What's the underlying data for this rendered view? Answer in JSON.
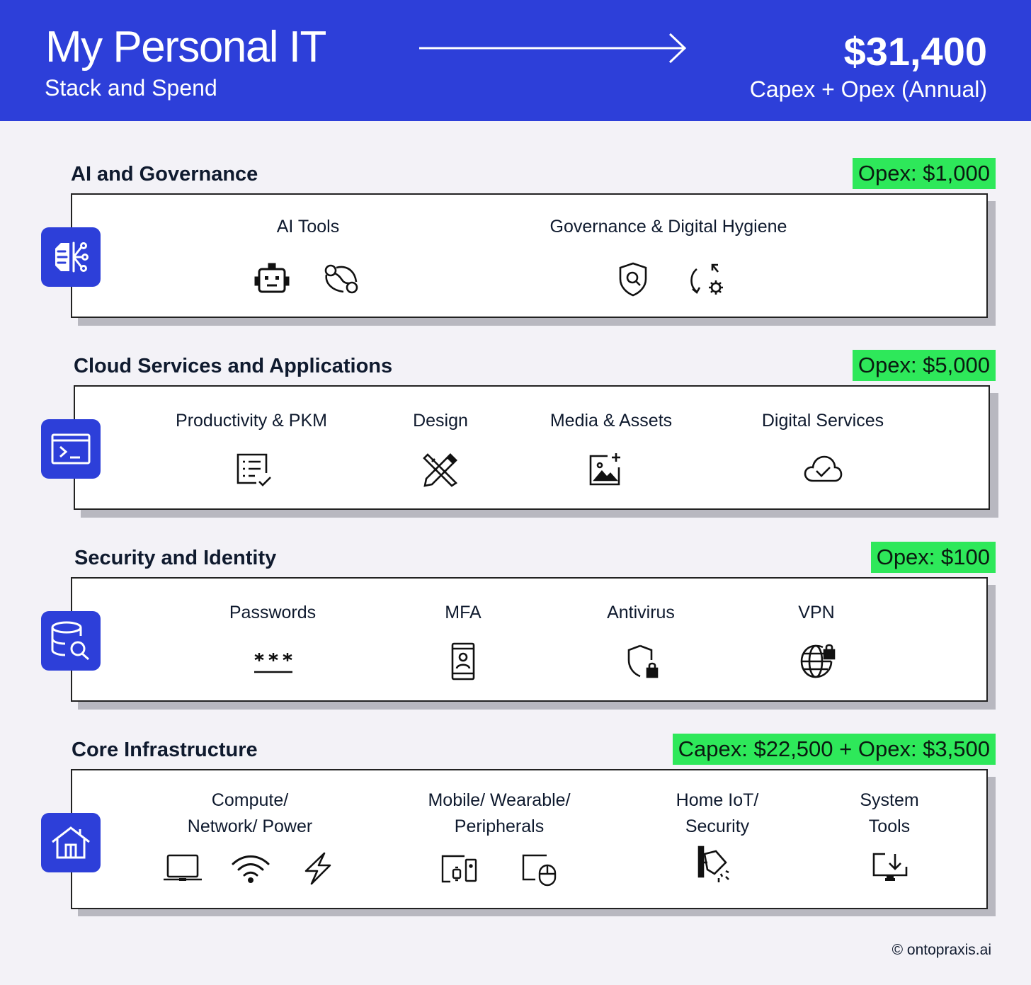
{
  "header": {
    "title": "My Personal IT",
    "subtitle": "Stack and Spend",
    "total": "$31,400",
    "total_caption": "Capex + Opex (Annual)"
  },
  "sections": [
    {
      "title": "AI and Governance",
      "badge": "Opex: $1,000",
      "icon": "ai-brain-network-icon",
      "items": [
        {
          "label": "AI Tools",
          "icons": [
            "robot-icon",
            "workflow-path-icon"
          ]
        },
        {
          "label": "Governance & Digital Hygiene",
          "icons": [
            "shield-search-icon",
            "refresh-settings-icon"
          ]
        }
      ]
    },
    {
      "title": "Cloud Services and Applications",
      "badge": "Opex: $5,000",
      "icon": "terminal-window-icon",
      "items": [
        {
          "label": "Productivity & PKM",
          "icons": [
            "checklist-icon"
          ]
        },
        {
          "label": "Design",
          "icons": [
            "pencil-ruler-icon"
          ]
        },
        {
          "label": "Media & Assets",
          "icons": [
            "add-image-icon"
          ]
        },
        {
          "label": "Digital Services",
          "icons": [
            "cloud-check-icon"
          ]
        }
      ]
    },
    {
      "title": "Security and Identity",
      "badge": "Opex: $100",
      "icon": "database-search-icon",
      "items": [
        {
          "label": "Passwords",
          "icons": [
            "password-field-icon"
          ]
        },
        {
          "label": "MFA",
          "icons": [
            "phone-user-icon"
          ]
        },
        {
          "label": "Antivirus",
          "icons": [
            "shield-lock-icon"
          ]
        },
        {
          "label": "VPN",
          "icons": [
            "globe-lock-icon"
          ]
        }
      ]
    },
    {
      "title": "Core Infrastructure",
      "badge": "Capex: $22,500 + Opex: $3,500",
      "icon": "home-icon",
      "items": [
        {
          "label": "Compute/",
          "label2": "Network/ Power",
          "icons": [
            "laptop-icon",
            "wifi-icon",
            "lightning-icon"
          ]
        },
        {
          "label": "Mobile/ Wearable/",
          "label2": "Peripherals",
          "icons": [
            "devices-icon",
            "mouse-icon"
          ]
        },
        {
          "label": "Home IoT/",
          "label2": "Security",
          "icons": [
            "security-camera-icon"
          ]
        },
        {
          "label": "System",
          "label2": "Tools",
          "icons": [
            "monitor-download-icon"
          ]
        }
      ]
    }
  ],
  "footer": {
    "copyright": "© ontopraxis.ai"
  },
  "colors": {
    "brand_blue": "#2d3fd9",
    "badge_green": "#2ee85a",
    "background": "#f3f2f7"
  }
}
